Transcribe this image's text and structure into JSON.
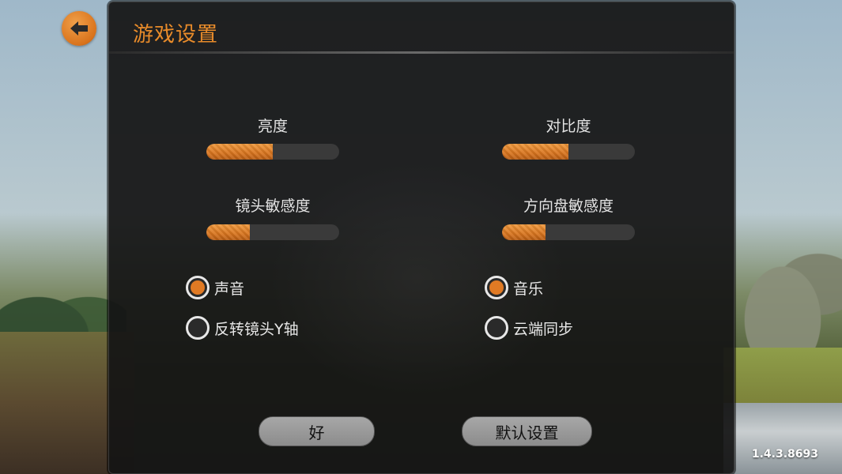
{
  "title": "游戏设置",
  "back_icon": "back-arrow-icon",
  "sliders": [
    {
      "label": "亮度",
      "value": 0.5
    },
    {
      "label": "对比度",
      "value": 0.5
    },
    {
      "label": "镜头敏感度",
      "value": 0.33
    },
    {
      "label": "方向盘敏感度",
      "value": 0.33
    }
  ],
  "toggles": [
    {
      "label": "声音",
      "checked": true
    },
    {
      "label": "音乐",
      "checked": true
    },
    {
      "label": "反转镜头Y轴",
      "checked": false
    },
    {
      "label": "云端同步",
      "checked": false
    }
  ],
  "buttons": {
    "ok": "好",
    "default": "默认设置"
  },
  "version": "1.4.3.8693",
  "colors": {
    "accent": "#e88b2a",
    "panel": "#141414",
    "button": "#9a9a9a"
  }
}
